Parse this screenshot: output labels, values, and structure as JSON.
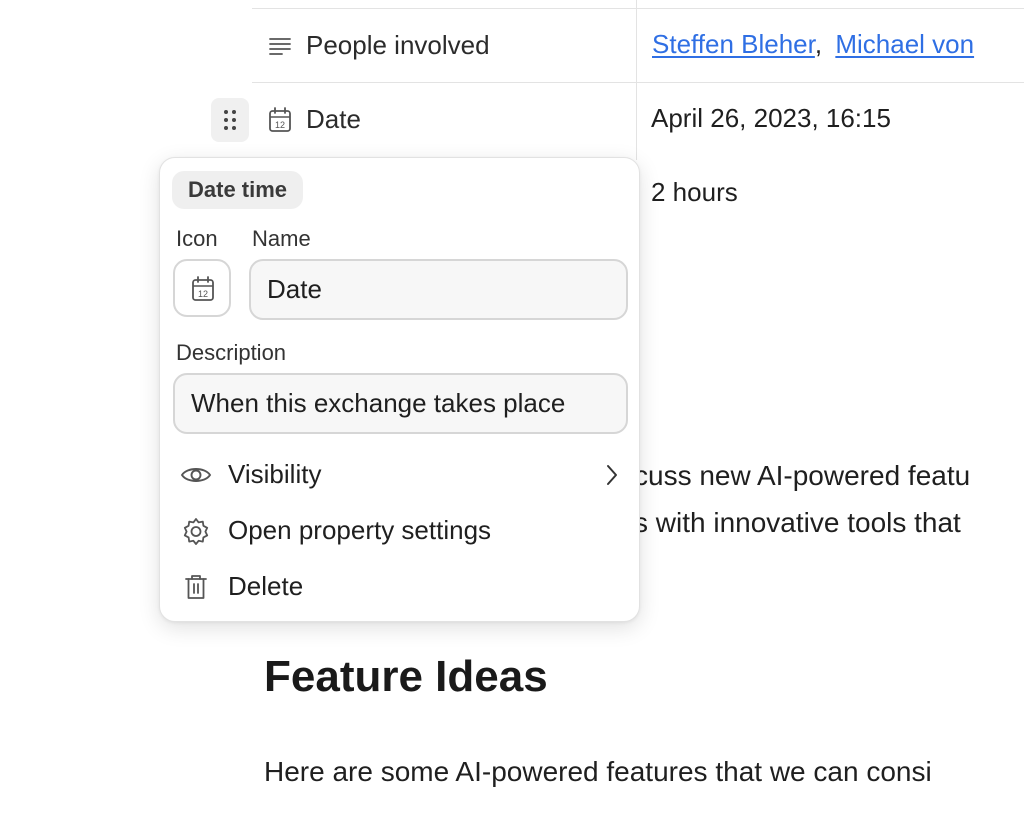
{
  "properties": [
    {
      "label": "People involved",
      "icon": "text-lines-icon",
      "people": [
        {
          "name": "Steffen Bleher",
          "sep": ","
        },
        {
          "name": "Michael von",
          "sep": ""
        }
      ]
    },
    {
      "label": "Date",
      "icon": "calendar-icon",
      "value": "April 26, 2023, 16:15"
    },
    {
      "value": "2 hours"
    }
  ],
  "content": {
    "line1_partial": "cuss new AI-powered featu",
    "line2_partial": "s with innovative tools that",
    "heading": "Feature Ideas",
    "paragraph_partial": "Here are some AI-powered features that we can consi"
  },
  "popup": {
    "type_badge": "Date time",
    "icon_label": "Icon",
    "name_label": "Name",
    "name_value": "Date",
    "description_label": "Description",
    "description_value": "When this exchange takes place",
    "menu": [
      {
        "label": "Visibility",
        "icon": "eye-icon",
        "has_submenu": true
      },
      {
        "label": "Open property settings",
        "icon": "gear-icon"
      },
      {
        "label": "Delete",
        "icon": "trash-icon"
      }
    ]
  },
  "colors": {
    "link": "#2f6fe4",
    "border": "#e3e3e3"
  }
}
